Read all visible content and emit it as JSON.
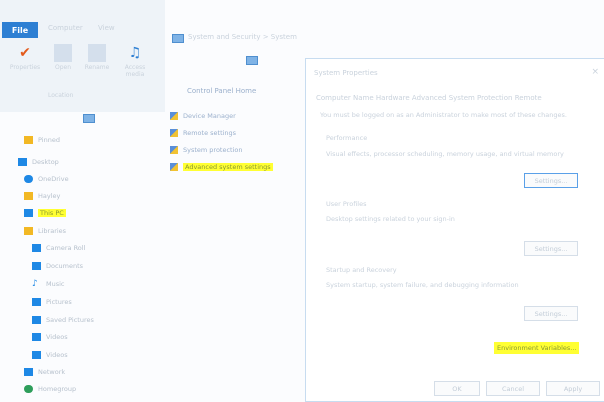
{
  "quick_access": {
    "check": "✔"
  },
  "ribbon": {
    "tabs": [
      "File",
      "Computer",
      "View"
    ],
    "buttons": [
      {
        "label": "Properties",
        "icon": "properties-check-icon"
      },
      {
        "label": "Open",
        "icon": "open-icon"
      },
      {
        "label": "Rename",
        "icon": "rename-icon"
      },
      {
        "label": "Access media",
        "icon": "media-icon"
      }
    ],
    "group_label": "Location"
  },
  "nav": {
    "items": [
      {
        "label": "Pinned",
        "icon": "star-icon",
        "color": "#f2b824"
      },
      {
        "label": "Desktop",
        "icon": "desktop-icon",
        "color": "#1e88e5"
      },
      {
        "label": "OneDrive",
        "icon": "cloud-icon",
        "color": "#1e88e5"
      },
      {
        "label": "Hayley",
        "icon": "folder-icon",
        "color": "#f2b824"
      },
      {
        "label": "This PC",
        "icon": "computer-icon",
        "color": "#1e88e5",
        "highlight": true
      },
      {
        "label": "Libraries",
        "icon": "library-icon",
        "color": "#f2b824"
      },
      {
        "label": "Camera Roll",
        "icon": "library-item-icon",
        "color": "#1e88e5"
      },
      {
        "label": "Documents",
        "icon": "library-item-icon",
        "color": "#1e88e5"
      },
      {
        "label": "Music",
        "icon": "music-icon",
        "color": "#1e88e5"
      },
      {
        "label": "Pictures",
        "icon": "library-item-icon",
        "color": "#1e88e5"
      },
      {
        "label": "Saved Pictures",
        "icon": "library-item-icon",
        "color": "#1e88e5"
      },
      {
        "label": "Videos",
        "icon": "library-item-icon",
        "color": "#1e88e5"
      },
      {
        "label": "Videos",
        "icon": "video-icon",
        "color": "#1e88e5"
      },
      {
        "label": "Network",
        "icon": "network-icon",
        "color": "#1e88e5"
      },
      {
        "label": "Homegroup",
        "icon": "homegroup-icon",
        "color": "#2e9e5b"
      }
    ]
  },
  "control_panel": {
    "address": "System and Security > System",
    "home": "Control Panel Home",
    "links": [
      {
        "label": "Device Manager",
        "highlight": false
      },
      {
        "label": "Remote settings",
        "highlight": false
      },
      {
        "label": "System protection",
        "highlight": false
      },
      {
        "label": "Advanced system settings",
        "highlight": true
      }
    ]
  },
  "dialog": {
    "title": "System Properties",
    "close": "×",
    "tabs": "Computer Name   Hardware   Advanced   System Protection   Remote",
    "note": "You must be logged on as an Administrator to make most of these changes.",
    "sections": [
      {
        "title": "Performance",
        "desc": "Visual effects, processor scheduling, memory usage, and virtual memory",
        "button": "Settings..."
      },
      {
        "title": "User Profiles",
        "desc": "Desktop settings related to your sign-in",
        "button": "Settings..."
      },
      {
        "title": "Startup and Recovery",
        "desc": "System startup, system failure, and debugging information",
        "button": "Settings..."
      }
    ],
    "env_button": "Environment Variables...",
    "ok": "OK",
    "cancel": "Cancel",
    "apply": "Apply"
  }
}
